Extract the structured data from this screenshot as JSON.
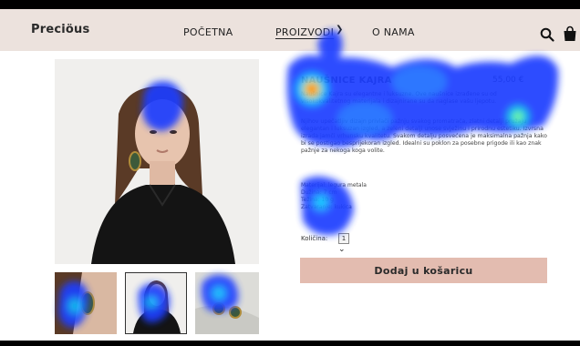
{
  "navbar": {
    "brand": "Preciöus",
    "links": [
      {
        "label": "POČETNA"
      },
      {
        "label": "PROIZVODI"
      },
      {
        "label": "O NAMA"
      }
    ],
    "icons": [
      "search-icon",
      "shopping-bag-icon",
      "chevron-down-icon"
    ]
  },
  "product": {
    "title": "NAUŠNICE KAJRA",
    "price": "55,00 €",
    "description_1": "Naušnice Kajra su elegantne i luksuzne. Ove naušnice izrađene su od visokokvalitetnog materijala i dizajnirane su da naglase vašu ljepotu.",
    "description_2": "Njihov upečatljiv dizajn privlači pažnju svakog promatrača, zlatni detalji pružaju elegantan i luksuzan izgled, a zeleni detalji unose svježinu i prirodnu estetiku. Izvrsna izrada jamči vrhunsku kvalitetu. Svakom detalju posvećena je maksimalna pažnja kako bi se postigao besprijekoran izgled. Idealni su poklon za posebne prigode ili kao znak pažnje za nekoga koga volite.",
    "materials": "Materijal: legura metala\nDužina: 7 cm\nTežina: 10 g\nZatvaranje: kukica",
    "quantity_label": "Količina:",
    "quantity_value": "1",
    "add_to_cart_label": "Dodaj u košaricu"
  },
  "colors": {
    "navbar_bg": "#ece2dd",
    "button_bg": "#e3bcb0",
    "text": "#2a2a2a"
  }
}
